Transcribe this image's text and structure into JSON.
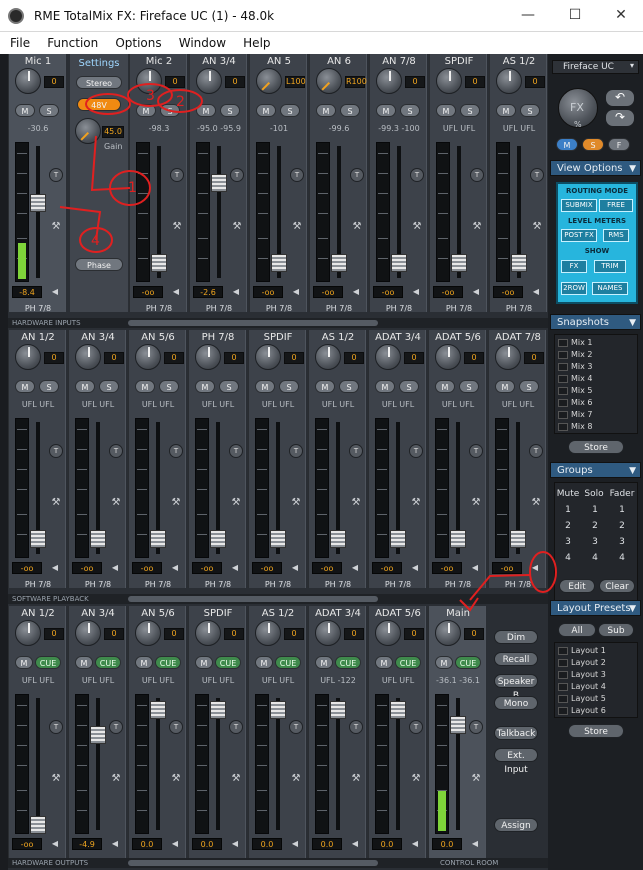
{
  "window": {
    "title": "RME TotalMix FX: Fireface UC (1) - 48.0k",
    "controls": [
      "—",
      "☐",
      "✕"
    ]
  },
  "menu": [
    "File",
    "Function",
    "Options",
    "Window",
    "Help"
  ],
  "inputs": {
    "label": "HARDWARE INPUTS",
    "channels": [
      {
        "name": "Mic 1",
        "gain": "0",
        "level": "-30.6",
        "bottom": "-8.4",
        "ph": "PH 7/8"
      },
      {
        "name": "Mic 2",
        "gain": "0",
        "level": "-98.3",
        "bottom": "-oo",
        "ph": "PH 7/8"
      },
      {
        "name": "AN 3/4",
        "gain": "0",
        "level": "-95.0 -95.9",
        "bottom": "-2.6",
        "ph": "PH 7/8"
      },
      {
        "name": "AN 5",
        "gain": "L100",
        "level": "-101",
        "bottom": "-oo",
        "ph": "PH 7/8"
      },
      {
        "name": "AN 6",
        "gain": "R100",
        "level": "-99.6",
        "bottom": "-oo",
        "ph": "PH 7/8"
      },
      {
        "name": "AN 7/8",
        "gain": "0",
        "level": "-99.3 -100",
        "bottom": "-oo",
        "ph": "PH 7/8"
      },
      {
        "name": "SPDIF",
        "gain": "0",
        "level": "UFL UFL",
        "bottom": "-oo",
        "ph": "PH 7/8"
      },
      {
        "name": "AS 1/2",
        "gain": "0",
        "level": "UFL UFL",
        "bottom": "-oo",
        "ph": "PH 7/8"
      }
    ],
    "settings": {
      "title": "Settings",
      "stereo": "Stereo",
      "p48": "48V",
      "gain_val": "45.0",
      "gain": "Gain",
      "phase": "Phase"
    }
  },
  "playback": {
    "label": "SOFTWARE PLAYBACK",
    "channels": [
      {
        "name": "AN 1/2",
        "gain": "0",
        "level": "UFL UFL",
        "bottom": "-oo",
        "ph": "PH 7/8"
      },
      {
        "name": "AN 3/4",
        "gain": "0",
        "level": "UFL UFL",
        "bottom": "-oo",
        "ph": "PH 7/8"
      },
      {
        "name": "AN 5/6",
        "gain": "0",
        "level": "UFL UFL",
        "bottom": "-oo",
        "ph": "PH 7/8"
      },
      {
        "name": "PH 7/8",
        "gain": "0",
        "level": "UFL UFL",
        "bottom": "-oo",
        "ph": "PH 7/8"
      },
      {
        "name": "SPDIF",
        "gain": "0",
        "level": "UFL UFL",
        "bottom": "-oo",
        "ph": "PH 7/8"
      },
      {
        "name": "AS 1/2",
        "gain": "0",
        "level": "UFL UFL",
        "bottom": "-oo",
        "ph": "PH 7/8"
      },
      {
        "name": "ADAT 3/4",
        "gain": "0",
        "level": "UFL UFL",
        "bottom": "-oo",
        "ph": "PH 7/8"
      },
      {
        "name": "ADAT 5/6",
        "gain": "0",
        "level": "UFL UFL",
        "bottom": "-oo",
        "ph": "PH 7/8"
      },
      {
        "name": "ADAT 7/8",
        "gain": "0",
        "level": "UFL UFL",
        "bottom": "-oo",
        "ph": "PH 7/8"
      }
    ]
  },
  "outputs": {
    "label": "HARDWARE OUTPUTS",
    "control_room": "CONTROL ROOM",
    "channels": [
      {
        "name": "AN 1/2",
        "gain": "0",
        "level": "UFL UFL",
        "bottom": "-oo"
      },
      {
        "name": "AN 3/4",
        "gain": "0",
        "level": "UFL UFL",
        "bottom": "-4.9"
      },
      {
        "name": "AN 5/6",
        "gain": "0",
        "level": "UFL UFL",
        "bottom": "0.0"
      },
      {
        "name": "SPDIF",
        "gain": "0",
        "level": "UFL UFL",
        "bottom": "0.0"
      },
      {
        "name": "AS 1/2",
        "gain": "0",
        "level": "UFL UFL",
        "bottom": "0.0"
      },
      {
        "name": "ADAT 3/4",
        "gain": "0",
        "level": "UFL -122",
        "bottom": "0.0"
      },
      {
        "name": "ADAT 5/6",
        "gain": "0",
        "level": "UFL UFL",
        "bottom": "0.0"
      }
    ],
    "main": {
      "name": "Main",
      "gain": "0",
      "level": "-36.1 -36.1",
      "bottom": "0.0"
    },
    "cr_buttons": [
      "Dim",
      "Recall",
      "Speaker B",
      "Mono",
      "Talkback",
      "Ext. Input",
      "Assign"
    ]
  },
  "right": {
    "device": "Fireface UC",
    "fx": "FX",
    "fx_pct": "%",
    "msf": [
      "M",
      "S",
      "F"
    ],
    "view_options": "View Options",
    "routing_mode": "ROUTING MODE",
    "submix": "SUBMIX",
    "free": "FREE",
    "level_meters": "LEVEL METERS",
    "postfx": "POST FX",
    "rms": "RMS",
    "show": "SHOW",
    "fx2": "FX",
    "trim": "TRIM",
    "row2": "2ROW",
    "names": "NAMES",
    "snapshots": "Snapshots",
    "mixes": [
      "Mix 1",
      "Mix 2",
      "Mix 3",
      "Mix 4",
      "Mix 5",
      "Mix 6",
      "Mix 7",
      "Mix 8"
    ],
    "store": "Store",
    "groups": "Groups",
    "group_hdr": [
      "Mute",
      "Solo",
      "Fader"
    ],
    "group_rows": [
      [
        "1",
        "1",
        "1"
      ],
      [
        "2",
        "2",
        "2"
      ],
      [
        "3",
        "3",
        "3"
      ],
      [
        "4",
        "4",
        "4"
      ]
    ],
    "edit": "Edit",
    "clear": "Clear",
    "layout_presets": "Layout Presets",
    "all": "All",
    "sub": "Sub",
    "layouts": [
      "Layout 1",
      "Layout 2",
      "Layout 3",
      "Layout 4",
      "Layout 5",
      "Layout 6"
    ],
    "store2": "Store"
  },
  "annotations": {
    "n1": "1",
    "n2": "2",
    "n3": "3",
    "n4": "4"
  }
}
